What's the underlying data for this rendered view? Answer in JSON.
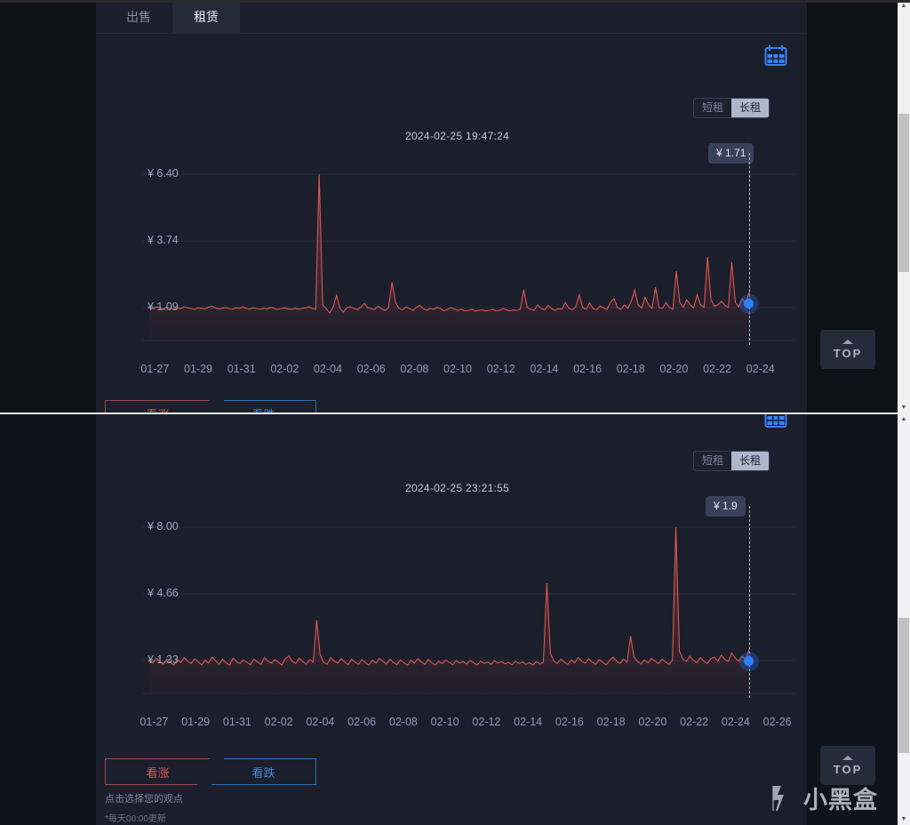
{
  "tabs": [
    {
      "label": "出售",
      "active": false,
      "name": "tab-sale"
    },
    {
      "label": "租赁",
      "active": true,
      "name": "tab-rent"
    }
  ],
  "term_toggle": {
    "short_label": "短租",
    "long_label": "长租",
    "selected": "长租"
  },
  "calendar_icon": "calendar-icon",
  "vote": {
    "up_label": "看涨",
    "down_label": "看跌",
    "hint": "点击选择您的观点",
    "note": "*每天00:00更新",
    "up_color": "#e0564f",
    "down_color": "#3c8ce0"
  },
  "top_button": {
    "label": "TOP"
  },
  "watermark": {
    "text": "小黑盒"
  },
  "accent": {
    "tab_active": "#d49a4a",
    "line": "#e0564f",
    "marker": "#2f80f5"
  },
  "chart_data": [
    {
      "id": "rent-long-chart-top",
      "type": "line",
      "title": "2024-02-25 19:47:24",
      "xlabel": "",
      "ylabel": "",
      "ylim": [
        0.0,
        7.2
      ],
      "ytick_labels": [
        "¥ 6.40",
        "¥ 3.74",
        "¥ 1.09"
      ],
      "ytick_values": [
        6.4,
        3.74,
        1.09
      ],
      "tick_labels": [
        "01-27",
        "01-29",
        "01-31",
        "02-02",
        "02-04",
        "02-06",
        "02-08",
        "02-10",
        "02-12",
        "02-14",
        "02-16",
        "02-18",
        "02-20",
        "02-22",
        "02-24"
      ],
      "grid": true,
      "marker": {
        "label": "¥ 1.71",
        "value": 1.71,
        "x_label": "02-25"
      },
      "values": [
        1.1,
        1.05,
        1.12,
        1.08,
        1.04,
        1.1,
        1.06,
        1.02,
        1.08,
        1.05,
        1.12,
        1.09,
        1.05,
        1.02,
        1.08,
        1.06,
        1.04,
        1.1,
        1.15,
        1.08,
        1.04,
        1.06,
        1.1,
        1.05,
        1.02,
        1.08,
        1.06,
        1.12,
        1.05,
        1.03,
        1.08,
        1.05,
        1.02,
        1.06,
        1.04,
        1.1,
        1.06,
        1.02,
        1.05,
        1.08,
        1.04,
        1.02,
        1.06,
        1.03,
        1.05,
        1.08,
        1.12,
        1.05,
        1.02,
        6.4,
        1.2,
        1.05,
        0.88,
        1.1,
        1.58,
        1.05,
        0.92,
        1.08,
        1.12,
        1.05,
        1.02,
        1.1,
        1.26,
        1.08,
        1.05,
        1.02,
        1.15,
        1.05,
        0.98,
        1.08,
        2.1,
        1.3,
        1.06,
        1.0,
        1.12,
        1.05,
        0.98,
        1.1,
        1.18,
        1.05,
        0.98,
        1.06,
        1.02,
        1.1,
        1.05,
        0.96,
        1.02,
        1.08,
        1.04,
        0.98,
        1.02,
        0.96,
        0.98,
        1.02,
        0.95,
        0.98,
        1.0,
        0.96,
        0.98,
        1.02,
        0.96,
        0.98,
        1.05,
        1.0,
        0.96,
        1.0,
        0.98,
        1.02,
        1.8,
        1.1,
        1.02,
        0.98,
        1.2,
        1.06,
        1.0,
        1.18,
        1.05,
        0.98,
        1.05,
        1.02,
        1.3,
        1.06,
        1.0,
        1.12,
        1.6,
        1.1,
        1.02,
        1.28,
        1.05,
        1.0,
        1.15,
        1.08,
        1.02,
        1.3,
        1.45,
        1.1,
        1.02,
        1.2,
        1.06,
        1.35,
        1.8,
        1.2,
        1.08,
        1.5,
        1.2,
        1.06,
        1.9,
        1.1,
        1.05,
        1.3,
        1.1,
        1.02,
        2.55,
        1.3,
        1.1,
        1.4,
        1.2,
        1.08,
        1.6,
        1.2,
        1.1,
        3.1,
        1.4,
        1.15,
        1.2,
        1.35,
        1.18,
        1.1,
        2.9,
        1.3,
        1.12,
        1.45,
        1.25,
        1.71
      ]
    },
    {
      "id": "rent-long-chart-bottom",
      "type": "line",
      "title": "2024-02-25 23:21:55",
      "xlabel": "",
      "ylabel": "",
      "ylim": [
        0.0,
        9.0
      ],
      "ytick_labels": [
        "¥ 8.00",
        "¥ 4.66",
        "¥ 1.33"
      ],
      "ytick_values": [
        8.0,
        4.66,
        1.33
      ],
      "tick_labels": [
        "01-27",
        "01-29",
        "01-31",
        "02-02",
        "02-04",
        "02-06",
        "02-08",
        "02-10",
        "02-12",
        "02-14",
        "02-16",
        "02-18",
        "02-20",
        "02-22",
        "02-24",
        "02-26"
      ],
      "grid": true,
      "marker": {
        "label": "¥ 1.9",
        "value": 1.9,
        "x_label": "02-26"
      },
      "values": [
        1.35,
        1.2,
        1.45,
        1.28,
        1.15,
        1.4,
        1.25,
        1.1,
        1.38,
        1.22,
        1.48,
        1.3,
        1.18,
        1.42,
        1.26,
        1.12,
        1.35,
        1.2,
        1.5,
        1.32,
        1.15,
        1.4,
        1.22,
        1.1,
        1.45,
        1.28,
        1.18,
        1.36,
        1.24,
        1.12,
        1.4,
        1.26,
        1.15,
        1.48,
        1.3,
        1.2,
        1.38,
        1.25,
        1.1,
        1.42,
        1.55,
        1.3,
        1.18,
        1.45,
        1.28,
        1.16,
        1.38,
        1.24,
        3.35,
        1.6,
        1.25,
        1.15,
        1.48,
        1.3,
        1.2,
        1.42,
        1.26,
        1.12,
        1.4,
        1.25,
        1.15,
        1.38,
        1.22,
        1.1,
        1.35,
        1.2,
        1.45,
        1.28,
        1.16,
        1.4,
        1.24,
        1.12,
        1.36,
        1.22,
        1.1,
        1.34,
        1.2,
        1.42,
        1.26,
        1.14,
        1.38,
        1.22,
        1.1,
        1.3,
        1.18,
        1.36,
        1.24,
        1.12,
        1.32,
        1.2,
        1.28,
        1.16,
        1.34,
        1.22,
        1.1,
        1.3,
        1.18,
        1.26,
        1.14,
        1.32,
        1.2,
        1.28,
        1.16,
        1.24,
        1.12,
        1.3,
        1.18,
        1.26,
        1.14,
        1.22,
        1.1,
        1.28,
        1.16,
        1.24,
        5.2,
        1.7,
        1.3,
        1.18,
        1.4,
        1.25,
        1.15,
        1.35,
        1.22,
        1.48,
        1.3,
        1.2,
        1.42,
        1.26,
        1.14,
        1.38,
        1.24,
        1.12,
        1.34,
        1.5,
        1.3,
        1.18,
        1.4,
        1.24,
        2.55,
        1.5,
        1.28,
        1.16,
        1.36,
        1.22,
        1.44,
        1.3,
        1.18,
        1.4,
        1.26,
        1.14,
        1.34,
        8.0,
        1.8,
        1.4,
        1.28,
        1.55,
        1.35,
        1.22,
        1.48,
        1.3,
        1.18,
        1.42,
        1.5,
        1.3,
        1.6,
        1.4,
        1.28,
        1.7,
        1.45,
        1.3,
        1.55,
        1.38,
        1.9
      ]
    }
  ]
}
